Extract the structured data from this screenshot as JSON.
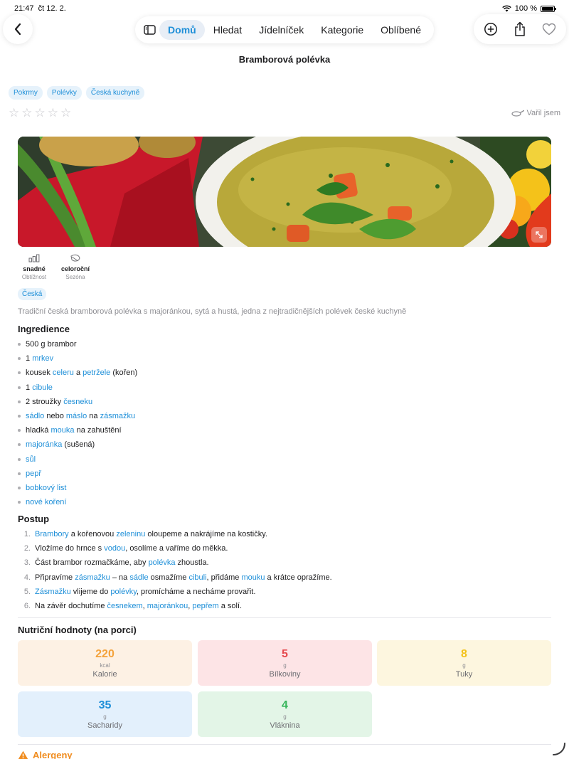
{
  "status_bar": {
    "time": "21:47",
    "date": "čt 12. 2.",
    "battery": "100 %"
  },
  "nav": {
    "tabs": [
      {
        "label": "Domů",
        "active": true
      },
      {
        "label": "Hledat",
        "active": false
      },
      {
        "label": "Jídelníček",
        "active": false
      },
      {
        "label": "Kategorie",
        "active": false
      },
      {
        "label": "Oblíbené",
        "active": false
      }
    ]
  },
  "recipe": {
    "title": "Bramborová polévka",
    "tags": [
      "Pokrmy",
      "Polévky",
      "Česká kuchyně"
    ],
    "rating_stars": 5,
    "cooked_label": "Vařil jsem",
    "difficulty": {
      "value": "snadné",
      "label": "Obtížnost"
    },
    "season": {
      "value": "celoroční",
      "label": "Sezóna"
    },
    "cuisine": "Česká",
    "description": "Tradiční česká bramborová polévka s majoránkou, sytá a hustá, jedna z nejtradičnějších polévek české kuchyně"
  },
  "ingredients": {
    "title": "Ingredience",
    "items": [
      [
        {
          "t": "500 g brambor"
        }
      ],
      [
        {
          "t": "1 "
        },
        {
          "t": "mrkev",
          "link": true
        }
      ],
      [
        {
          "t": "kousek "
        },
        {
          "t": "celeru",
          "link": true
        },
        {
          "t": " a "
        },
        {
          "t": "petržele",
          "link": true
        },
        {
          "t": " (kořen)"
        }
      ],
      [
        {
          "t": "1 "
        },
        {
          "t": "cibule",
          "link": true
        }
      ],
      [
        {
          "t": "2 stroužky "
        },
        {
          "t": "česneku",
          "link": true
        }
      ],
      [
        {
          "t": "sádlo",
          "link": true
        },
        {
          "t": " nebo "
        },
        {
          "t": "máslo",
          "link": true
        },
        {
          "t": " na "
        },
        {
          "t": "zásmažku",
          "link": true
        }
      ],
      [
        {
          "t": "hladká "
        },
        {
          "t": "mouka",
          "link": true
        },
        {
          "t": " na zahuštění"
        }
      ],
      [
        {
          "t": "majoránka",
          "link": true
        },
        {
          "t": " (sušená)"
        }
      ],
      [
        {
          "t": "sůl",
          "link": true
        }
      ],
      [
        {
          "t": "pepř",
          "link": true
        }
      ],
      [
        {
          "t": "bobkový list",
          "link": true
        }
      ],
      [
        {
          "t": "nové koření",
          "link": true
        }
      ]
    ]
  },
  "steps": {
    "title": "Postup",
    "items": [
      [
        {
          "t": "Brambory",
          "link": true
        },
        {
          "t": " a kořenovou "
        },
        {
          "t": "zeleninu",
          "link": true
        },
        {
          "t": " oloupeme a nakrájíme na kostičky."
        }
      ],
      [
        {
          "t": "Vložíme do hrnce s "
        },
        {
          "t": "vodou",
          "link": true
        },
        {
          "t": ", osolíme a vaříme do měkka."
        }
      ],
      [
        {
          "t": "Část brambor rozmačkáme, aby "
        },
        {
          "t": "polévka",
          "link": true
        },
        {
          "t": " zhoustla."
        }
      ],
      [
        {
          "t": "Připravíme "
        },
        {
          "t": "zásmažku",
          "link": true
        },
        {
          "t": " – na "
        },
        {
          "t": "sádle",
          "link": true
        },
        {
          "t": " osmažíme "
        },
        {
          "t": "cibuli",
          "link": true
        },
        {
          "t": ", přidáme "
        },
        {
          "t": "mouku",
          "link": true
        },
        {
          "t": " a krátce opražíme."
        }
      ],
      [
        {
          "t": "Zásmažku",
          "link": true
        },
        {
          "t": " vlijeme do "
        },
        {
          "t": "polévky",
          "link": true
        },
        {
          "t": ", promícháme a necháme provařit."
        }
      ],
      [
        {
          "t": "Na závěr dochutíme "
        },
        {
          "t": "česnekem",
          "link": true
        },
        {
          "t": ", "
        },
        {
          "t": "majoránkou",
          "link": true
        },
        {
          "t": ", "
        },
        {
          "t": "pepřem",
          "link": true
        },
        {
          "t": " a solí."
        }
      ]
    ]
  },
  "nutrition": {
    "title": "Nutriční hodnoty (na porci)",
    "items": [
      {
        "value": "220",
        "unit": "kcal",
        "label": "Kalorie",
        "color": "#f4a23a",
        "bg": "#fdf1e4"
      },
      {
        "value": "5",
        "unit": "g",
        "label": "Bílkoviny",
        "color": "#e5484d",
        "bg": "#fde4e6"
      },
      {
        "value": "8",
        "unit": "g",
        "label": "Tuky",
        "color": "#f2c21a",
        "bg": "#fdf6df"
      },
      {
        "value": "35",
        "unit": "g",
        "label": "Sacharidy",
        "color": "#1e8fd8",
        "bg": "#e3f0fc"
      },
      {
        "value": "4",
        "unit": "g",
        "label": "Vláknina",
        "color": "#35b55a",
        "bg": "#e3f5e7"
      }
    ]
  },
  "allergens": {
    "title": "Alergeny"
  },
  "colors": {
    "accent": "#1e8fd8",
    "link": "#1e8fd8",
    "secondary_text": "#8e8e93",
    "warning": "#f08c1e"
  },
  "icons": [
    "back-icon",
    "sidebar-icon",
    "add-icon",
    "share-icon",
    "heart-icon",
    "star-icon",
    "pan-icon",
    "expand-icon",
    "difficulty-icon",
    "leaf-icon",
    "warning-icon"
  ]
}
